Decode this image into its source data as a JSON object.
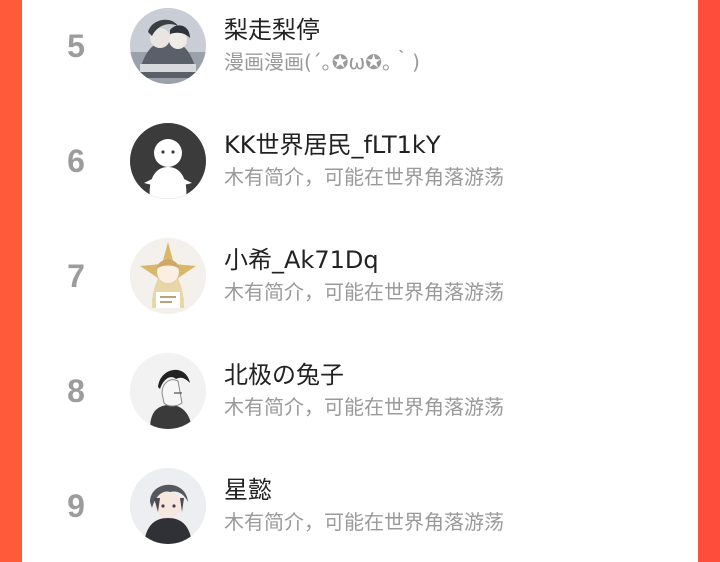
{
  "ranking": {
    "items": [
      {
        "rank": "5",
        "name": "梨走梨停",
        "intro": "漫画漫画(´｡✪ω✪｡｀)",
        "avatar": "anime-group-avatar"
      },
      {
        "rank": "6",
        "name": "KK世界居民_fLT1kY",
        "intro": "木有简介，可能在世界角落游荡",
        "avatar": "default-ghost-avatar"
      },
      {
        "rank": "7",
        "name": "小希_Ak71Dq",
        "intro": "木有简介，可能在世界角落游荡",
        "avatar": "anime-girl-star-avatar"
      },
      {
        "rank": "8",
        "name": "北极の兔子",
        "intro": "木有简介，可能在世界角落游荡",
        "avatar": "anime-boy-sketch-avatar"
      },
      {
        "rank": "9",
        "name": "星懿",
        "intro": "木有简介，可能在世界角落游荡",
        "avatar": "anime-boy-dark-hair-avatar"
      }
    ]
  },
  "colors": {
    "accent": "#ff4d3c",
    "rank_text": "#9c9c9c",
    "name_text": "#222222",
    "intro_text": "#9a9a9a"
  }
}
